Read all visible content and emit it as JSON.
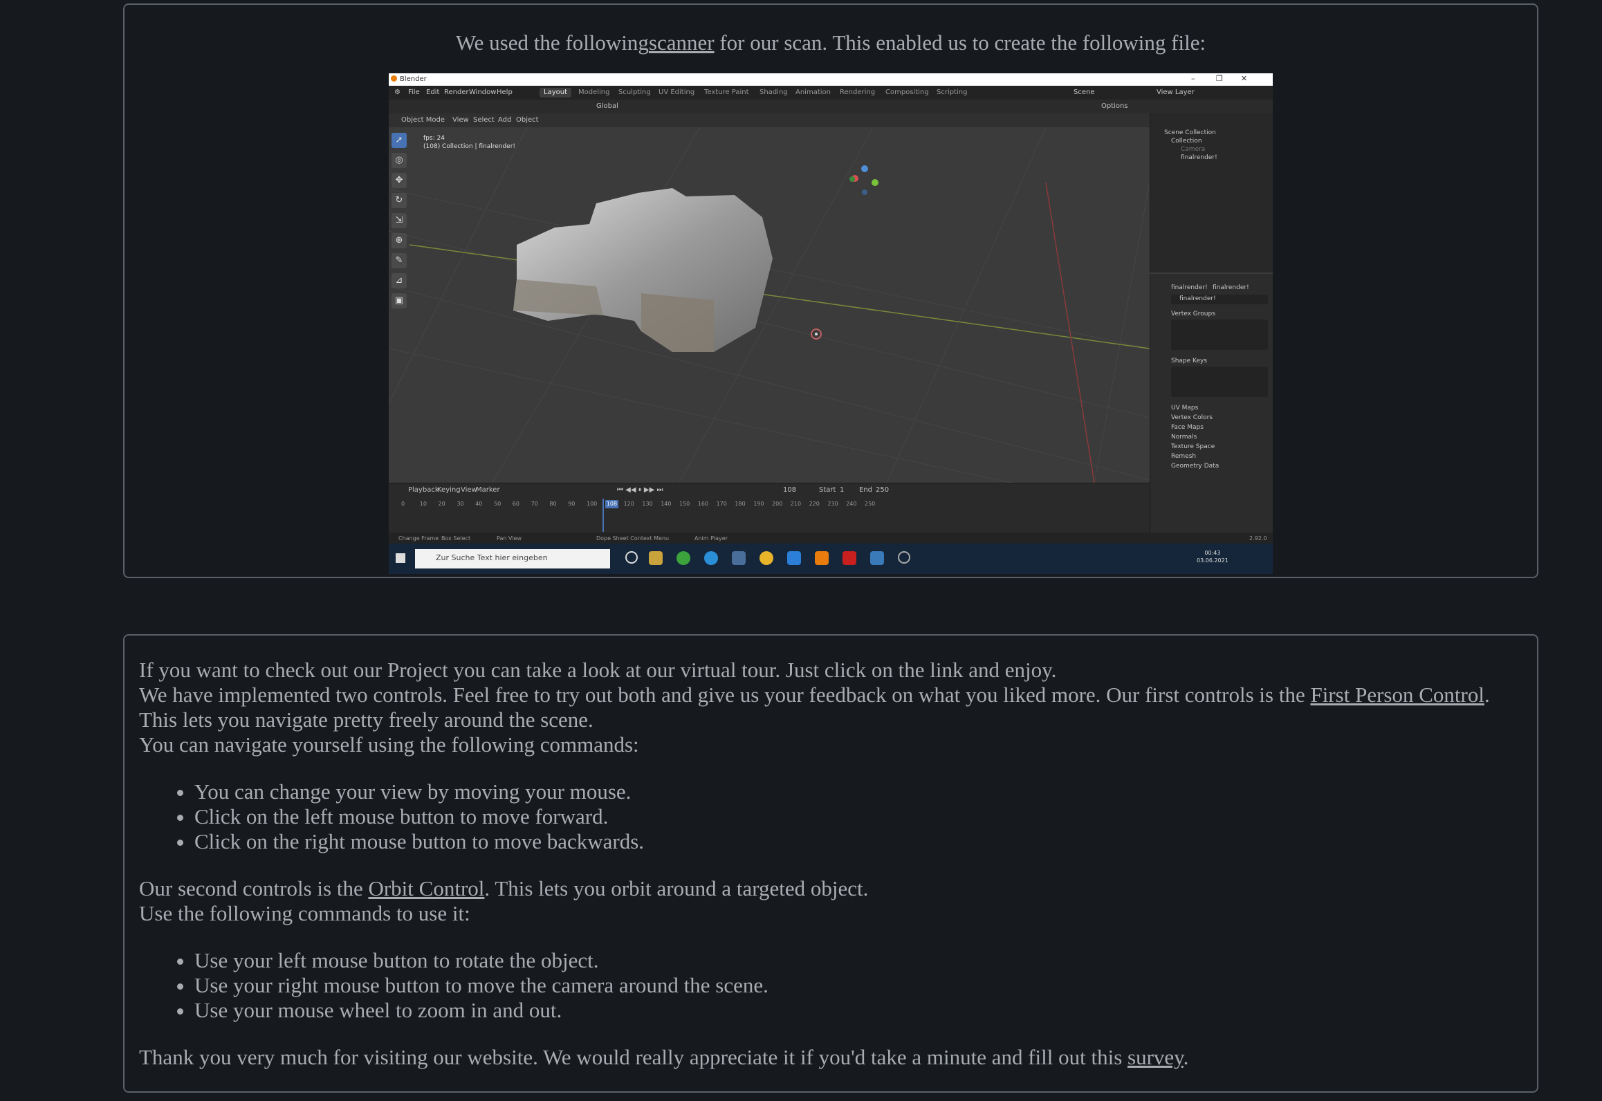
{
  "intro": {
    "prefix": "We used the following",
    "link": "scanner",
    "suffix": " for our scan. This enabled us to create the following file:"
  },
  "blender": {
    "window_title": "Blender",
    "menu": [
      "File",
      "Edit",
      "Render",
      "Window",
      "Help"
    ],
    "workspaces": [
      "Layout",
      "Modeling",
      "Sculpting",
      "UV Editing",
      "Texture Paint",
      "Shading",
      "Animation",
      "Rendering",
      "Compositing",
      "Scripting"
    ],
    "scene": "Scene",
    "view_layer": "View Layer",
    "tool_header": {
      "orientation": "Global",
      "options": "Options"
    },
    "viewport_header": [
      "Object Mode",
      "View",
      "Select",
      "Add",
      "Object"
    ],
    "viewport_info": {
      "fps": "fps: 24",
      "collection": "(108) Collection | finalrender!"
    },
    "outliner": {
      "root": "Scene Collection",
      "collection": "Collection",
      "items": [
        "Camera",
        "finalrender!"
      ]
    },
    "properties": {
      "object": "finalrender!",
      "mesh": "finalrender!",
      "data": "finalrender!",
      "sections": [
        "Vertex Groups",
        "Shape Keys",
        "UV Maps",
        "Vertex Colors",
        "Face Maps",
        "Normals",
        "Texture Space",
        "Remesh",
        "Geometry Data"
      ]
    },
    "timeline": {
      "menus": [
        "Playback",
        "Keying",
        "View",
        "Marker"
      ],
      "current_frame": "108",
      "start_label": "Start",
      "start": "1",
      "end_label": "End",
      "end": "250",
      "ticks": [
        "0",
        "10",
        "20",
        "30",
        "40",
        "50",
        "60",
        "70",
        "80",
        "90",
        "100",
        "108",
        "120",
        "130",
        "140",
        "150",
        "160",
        "170",
        "180",
        "190",
        "200",
        "210",
        "220",
        "230",
        "240",
        "250"
      ]
    },
    "statusbar": [
      "Change Frame",
      "Box Select",
      "Pan View",
      "Dope Sheet Context Menu",
      "Anim Player",
      "2.92.0"
    ],
    "taskbar": {
      "search_placeholder": "Zur Suche Text hier eingeben",
      "time": "00:43",
      "date": "03.06.2021"
    }
  },
  "tour": {
    "p1": "If you want to check out our Project you can take a look at our virtual tour. Just click on the link and enjoy.",
    "p2_prefix": "We have implemented two controls. Feel free to try out both and give us your feedback on what you liked more. Our first controls is the ",
    "p2_link": "First Person Control",
    "p2_suffix": ". This lets you navigate pretty freely around the scene.",
    "p3": "You can navigate yourself using the following commands:",
    "list1": [
      "You can change your view by moving your mouse.",
      "Click on the left mouse button to move forward.",
      "Click on the right mouse button to move backwards."
    ],
    "p4_prefix": "Our second controls is the ",
    "p4_link": "Orbit Control",
    "p4_suffix": ". This lets you orbit around a targeted object.",
    "p5": "Use the following commands to use it:",
    "list2": [
      "Use your left mouse button to rotate the object.",
      "Use your right mouse button to move the camera around the scene.",
      "Use your mouse wheel to zoom in and out."
    ],
    "p6_prefix": "Thank you very much for visiting our website. We would really appreciate it if you'd take a minute and fill out this ",
    "p6_link": "survey",
    "p6_suffix": "."
  }
}
